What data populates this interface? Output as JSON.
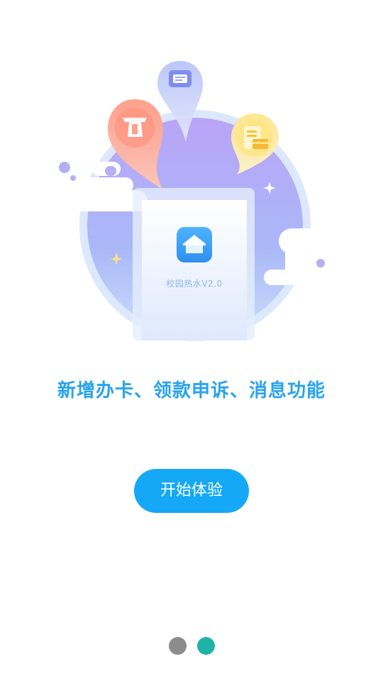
{
  "illustration": {
    "app_caption": "校园热水V2.0",
    "icons": [
      "home-app-icon",
      "message-bubble-icon",
      "card-reader-icon",
      "document-icon"
    ]
  },
  "headline": "新增办卡、领款申诉、消息功能",
  "start_button": {
    "label": "开始体验"
  },
  "pager": {
    "page_count": 2,
    "current_page": 2
  },
  "colors": {
    "accent": "#15a8f6",
    "headline": "#27a3ef",
    "dot_active": "#1fb3a8",
    "dot_inactive": "#8c8c8c"
  }
}
